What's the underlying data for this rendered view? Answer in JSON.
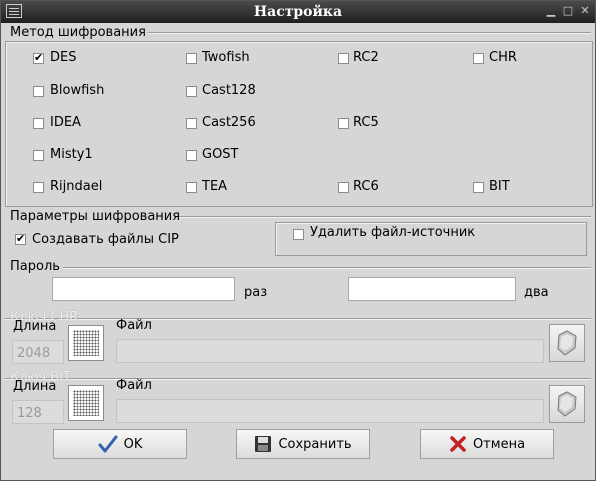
{
  "window": {
    "title": "Настройка"
  },
  "method": {
    "group_label": "Метод шифрования",
    "items": [
      {
        "label": "DES",
        "checked": true
      },
      {
        "label": "Twofish",
        "checked": false
      },
      {
        "label": "RC2",
        "checked": false
      },
      {
        "label": "CHR",
        "checked": false
      },
      {
        "label": "Blowfish",
        "checked": false
      },
      {
        "label": "Cast128",
        "checked": false
      },
      {
        "label": "IDEA",
        "checked": false
      },
      {
        "label": "Cast256",
        "checked": false
      },
      {
        "label": "RC5",
        "checked": false
      },
      {
        "label": "Misty1",
        "checked": false
      },
      {
        "label": "GOST",
        "checked": false
      },
      {
        "label": "Rijndael",
        "checked": false
      },
      {
        "label": "TEA",
        "checked": false
      },
      {
        "label": "RC6",
        "checked": false
      },
      {
        "label": "BIT",
        "checked": false
      }
    ]
  },
  "params": {
    "group_label": "Параметры шифрования",
    "create_cip": {
      "label": "Создавать файлы CIP",
      "checked": true
    },
    "delete_source": {
      "label": "Удалить файл-источник",
      "checked": false
    }
  },
  "password": {
    "group_label": "Пароль",
    "field1_value": "",
    "field1_suffix": "раз",
    "field2_value": "",
    "field2_suffix": "два"
  },
  "key_chr": {
    "group_label": "Ключ CHR",
    "length_label": "Длина",
    "length_value": "2048",
    "file_label": "Файл",
    "file_value": ""
  },
  "key_bit": {
    "group_label": "Ключ BIT",
    "length_label": "Длина",
    "length_value": "128",
    "file_label": "Файл",
    "file_value": ""
  },
  "buttons": {
    "ok": "OK",
    "save": "Сохранить",
    "cancel": "Отмена"
  }
}
